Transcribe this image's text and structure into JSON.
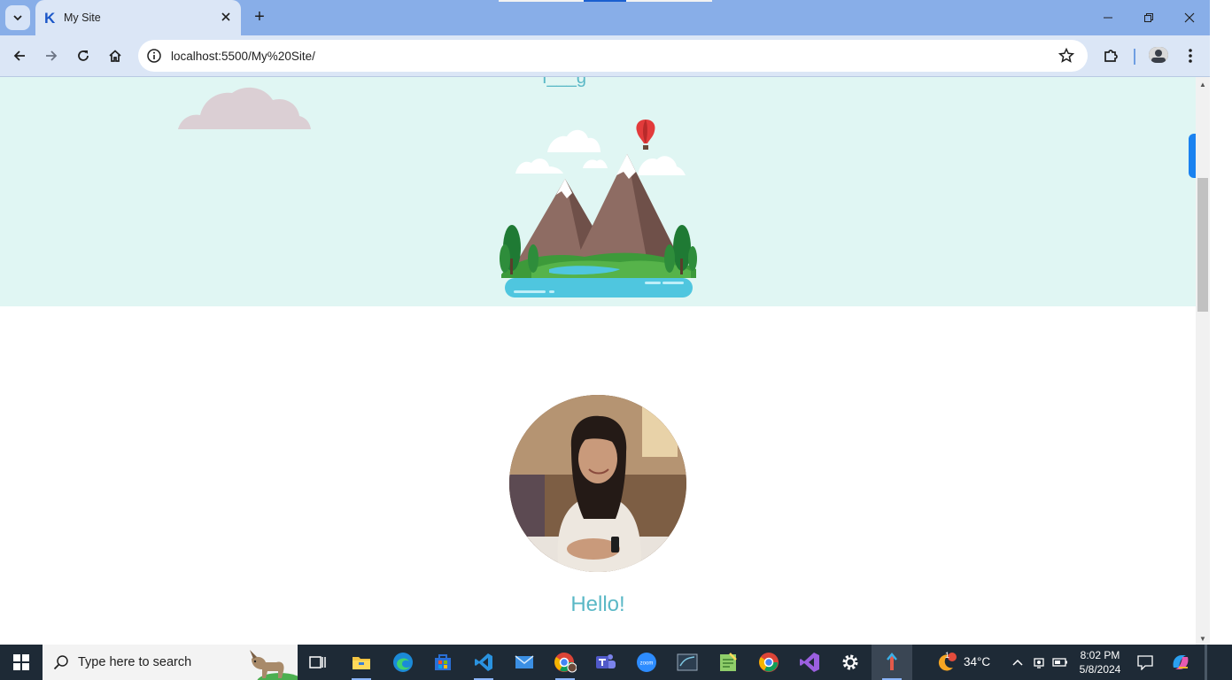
{
  "browser": {
    "tab_title": "My Site",
    "favicon_letter": "K",
    "new_tab_symbol": "+",
    "url": "localhost:5500/My%20Site/",
    "accent": "#1a82f0"
  },
  "page": {
    "cut_off_heading": "I___g",
    "greeting": "Hello!",
    "accent_color": "#5ab8c6",
    "hero_bg": "#e0f6f3"
  },
  "taskbar": {
    "search_placeholder": "Type here to search",
    "apps": [
      "task-view-icon",
      "file-explorer-icon",
      "edge-icon",
      "store-icon",
      "vscode-icon",
      "mail-icon",
      "chrome-profile-icon",
      "teams-icon",
      "zoom-icon",
      "sql-icon",
      "notepad-icon",
      "chrome-icon",
      "visual-studio-icon",
      "settings-icon",
      "active-app-icon"
    ],
    "weather_temp": "34°C",
    "weather_badge": "1",
    "time": "8:02 PM",
    "date": "5/8/2024"
  }
}
